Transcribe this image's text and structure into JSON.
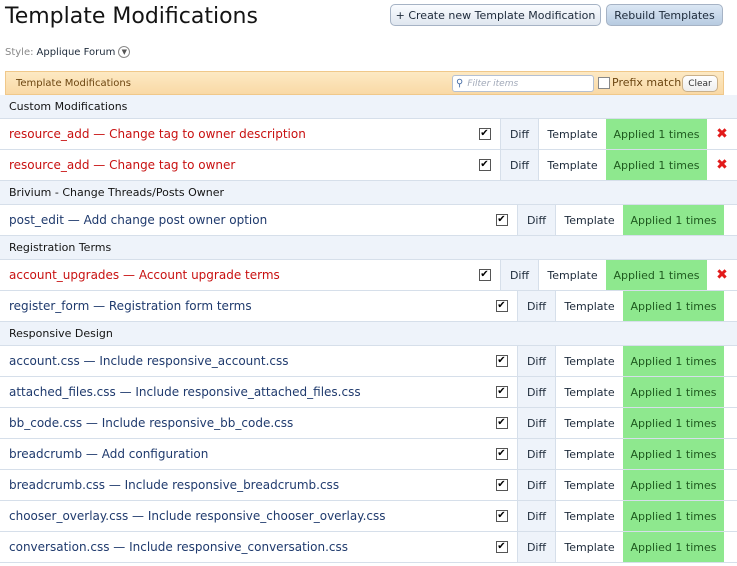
{
  "page": {
    "title": "Template Modifications",
    "new_button": "+ Create new Template Modification",
    "rebuild_button": "Rebuild Templates"
  },
  "style": {
    "label": "Style:",
    "value": "Applique Forum"
  },
  "list_header": {
    "title": "Template Modifications",
    "filter_placeholder": "Filter items",
    "prefix_label": "Prefix match",
    "clear_label": "Clear"
  },
  "labels": {
    "diff": "Diff",
    "template": "Template",
    "applied": "Applied 1 times",
    "delete_icon": "✖",
    "check": "✔"
  },
  "groups": [
    {
      "title": "Custom Modifications",
      "rows": [
        {
          "name": "resource_add — Change tag to owner description",
          "deletable": true,
          "checked": true
        },
        {
          "name": "resource_add — Change tag to owner",
          "deletable": true,
          "checked": true
        }
      ]
    },
    {
      "title": "Brivium - Change Threads/Posts Owner",
      "rows": [
        {
          "name": "post_edit — Add change post owner option",
          "deletable": false,
          "checked": true
        }
      ]
    },
    {
      "title": "Registration Terms",
      "rows": [
        {
          "name": "account_upgrades — Account upgrade terms",
          "deletable": true,
          "checked": true
        },
        {
          "name": "register_form — Registration form terms",
          "deletable": false,
          "checked": true
        }
      ]
    },
    {
      "title": "Responsive Design",
      "rows": [
        {
          "name": "account.css — Include responsive_account.css",
          "deletable": false,
          "checked": true
        },
        {
          "name": "attached_files.css — Include responsive_attached_files.css",
          "deletable": false,
          "checked": true
        },
        {
          "name": "bb_code.css — Include responsive_bb_code.css",
          "deletable": false,
          "checked": true
        },
        {
          "name": "breadcrumb — Add configuration",
          "deletable": false,
          "checked": true
        },
        {
          "name": "breadcrumb.css — Include responsive_breadcrumb.css",
          "deletable": false,
          "checked": true
        },
        {
          "name": "chooser_overlay.css — Include responsive_chooser_overlay.css",
          "deletable": false,
          "checked": true
        },
        {
          "name": "conversation.css — Include responsive_conversation.css",
          "deletable": false,
          "checked": true
        }
      ]
    }
  ],
  "colors": {
    "applied_bg": "#8ee88e",
    "red_text": "#c81010",
    "link_text": "#1f3a6d",
    "header_bg": "#fde9c3"
  }
}
